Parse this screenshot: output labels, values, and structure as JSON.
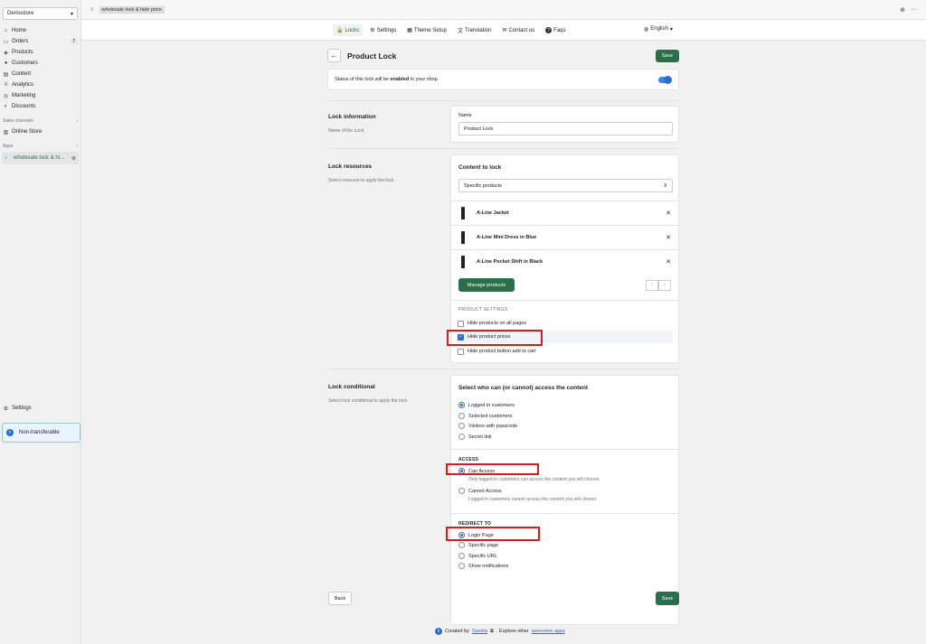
{
  "topbar": {
    "title": "wholesale lock & hide price",
    "pin": "⊕",
    "more": "···"
  },
  "sidebar": {
    "store": "Demostore",
    "items": [
      {
        "label": "Home",
        "icon": "⌂"
      },
      {
        "label": "Orders",
        "icon": "▭",
        "badge": "7"
      },
      {
        "label": "Products",
        "icon": "◈"
      },
      {
        "label": "Customers",
        "icon": "●"
      },
      {
        "label": "Content",
        "icon": "▤"
      },
      {
        "label": "Analytics",
        "icon": "ıl"
      },
      {
        "label": "Marketing",
        "icon": "◎"
      },
      {
        "label": "Discounts",
        "icon": "◐"
      }
    ],
    "sales_channels_label": "Sales channels",
    "online_store": "Online Store",
    "apps_label": "Apps",
    "app_item": "wholesale lock & hi...",
    "settings": "Settings",
    "non_transferable": "Non-transferable"
  },
  "appnav": {
    "tabs": [
      {
        "label": "Locks",
        "icon": "🔒"
      },
      {
        "label": "Settings",
        "icon": "⚙"
      },
      {
        "label": "Theme Setup",
        "icon": "▦"
      },
      {
        "label": "Translation",
        "icon": "文"
      },
      {
        "label": "Contact us",
        "icon": "✉"
      },
      {
        "label": "Faqs",
        "icon": "?"
      }
    ],
    "language": "English"
  },
  "page": {
    "title": "Product Lock",
    "save": "Save",
    "back": "Back",
    "status_prefix": "Status of this lock will be ",
    "status_bold": "enabled",
    "status_suffix": " in your shop."
  },
  "lock_info": {
    "title": "Lock information",
    "sub": "Name of the Lock.",
    "name_label": "Name",
    "name_value": "Product Lock"
  },
  "lock_resources": {
    "title": "Lock resources",
    "sub": "Select resource to apply the lock.",
    "content_label": "Content to lock",
    "select_value": "Specific products",
    "products": [
      "A-Line Jacket",
      "A-Line Mini Dress in Blue",
      "A-Line Pocket Shift in Black"
    ],
    "manage": "Manage products",
    "settings_heading": "PRODUCT SETTINGS",
    "options": [
      {
        "label": "Hide products on all pages",
        "checked": false
      },
      {
        "label": "Hide product prices",
        "checked": true
      },
      {
        "label": "Hide product button add to cart",
        "checked": false
      }
    ]
  },
  "lock_conditional": {
    "title": "Lock conditional",
    "sub": "Select lock conditional to apply the lock.",
    "who_label": "Select who can (or cannot) access the content",
    "who_options": [
      "Logged in customers",
      "Selected customers",
      "Visitors with passcode",
      "Secret link"
    ],
    "access_heading": "ACCESS",
    "can_access": "Can Access",
    "can_help": "Only logged in customers can access the content you will choose.",
    "cannot_access": "Cannot Access",
    "cannot_help": "Logged in customers cannot access the content you will choose.",
    "redirect_heading": "REDIRECT TO",
    "redirect_options": [
      "Login Page",
      "Specific page",
      "Specific URL",
      "Show notifications"
    ]
  },
  "footer": {
    "created_by": "Created by",
    "author": "Samita",
    "middle": ". Explore other",
    "link": "awesome apps"
  },
  "colors": {
    "primary": "#2c6e49",
    "accent": "#2c6ecb",
    "highlight": "#d81b1b"
  }
}
